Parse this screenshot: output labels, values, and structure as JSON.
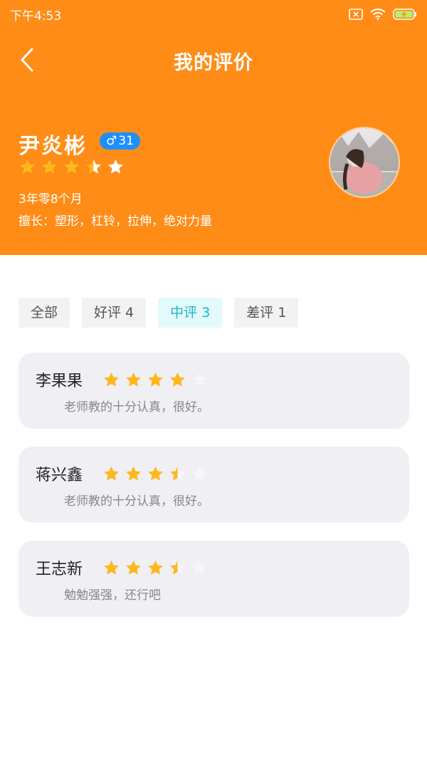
{
  "status_bar": {
    "time": "下午4:53"
  },
  "nav": {
    "title": "我的评价"
  },
  "coach": {
    "name": "尹炎彬",
    "gender_symbol": "♂",
    "age": "31",
    "rating": 3.5,
    "experience": "3年零8个月",
    "specialty": "擅长：塑形，杠铃，拉伸，绝对力量"
  },
  "filters": [
    {
      "label": "全部",
      "active": false
    },
    {
      "label": "好评 4",
      "active": false
    },
    {
      "label": "中评 3",
      "active": true
    },
    {
      "label": "差评 1",
      "active": false
    }
  ],
  "reviews": [
    {
      "name": "李果果",
      "rating": 4,
      "text": "老师教的十分认真，很好。"
    },
    {
      "name": "蒋兴鑫",
      "rating": 3.5,
      "text": "老师教的十分认真，很好。"
    },
    {
      "name": "王志新",
      "rating": 3.5,
      "text": "勉勉强强，还行吧"
    }
  ],
  "colors": {
    "header_bg": "#FF8C17",
    "star_filled": "#FFB81C",
    "star_empty_header": "#FFFFFF",
    "star_empty_card": "#F7F7FA",
    "active_tab_text": "#19B7C8",
    "badge_bg": "#1E8FFF"
  }
}
